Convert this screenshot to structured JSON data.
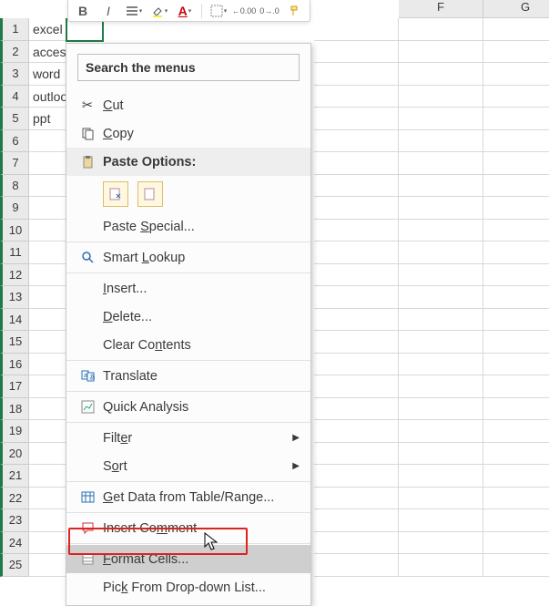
{
  "columns": [
    "F",
    "G"
  ],
  "rows": [
    "1",
    "2",
    "3",
    "4",
    "5",
    "6",
    "7",
    "8",
    "9",
    "10",
    "11",
    "12",
    "13",
    "14",
    "15",
    "16",
    "17",
    "18",
    "19",
    "20",
    "21",
    "22",
    "23",
    "24",
    "25"
  ],
  "cells": {
    "a1": "excel",
    "a2": "access",
    "a3": "word",
    "a4": "outlook",
    "a5": "ppt"
  },
  "ctx": {
    "search_placeholder": "Search the menus",
    "cut": "Cut",
    "copy": "Copy",
    "paste_options": "Paste Options:",
    "paste_special": "Paste Special...",
    "smart_lookup": "Smart Lookup",
    "insert": "Insert...",
    "delete": "Delete...",
    "clear": "Clear Contents",
    "translate": "Translate",
    "quick_analysis": "Quick Analysis",
    "filter": "Filter",
    "sort": "Sort",
    "get_data": "Get Data from Table/Range...",
    "insert_comment": "Insert Comment",
    "format_cells": "Format Cells...",
    "pick_list": "Pick From Drop-down List..."
  },
  "toolbar": {
    "bold": "B",
    "italic": "I",
    "dec0": ".0",
    "dec00": ".00"
  }
}
